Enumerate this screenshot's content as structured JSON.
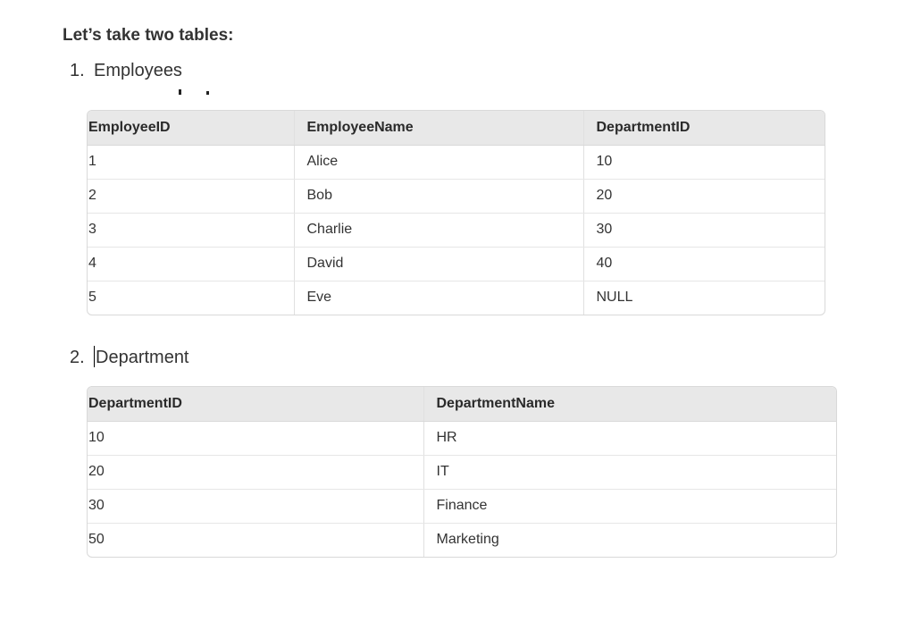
{
  "heading": "Let’s take two tables:",
  "list": [
    {
      "number": "1.",
      "label": "Employees"
    },
    {
      "number": "2.",
      "label": "Department"
    }
  ],
  "employees_table": {
    "headers": [
      "EmployeeID",
      "EmployeeName",
      "DepartmentID"
    ],
    "rows": [
      [
        "1",
        "Alice",
        "10"
      ],
      [
        "2",
        "Bob",
        "20"
      ],
      [
        "3",
        "Charlie",
        "30"
      ],
      [
        "4",
        "David",
        "40"
      ],
      [
        "5",
        "Eve",
        "NULL"
      ]
    ]
  },
  "department_table": {
    "headers": [
      "DepartmentID",
      "DepartmentName"
    ],
    "rows": [
      [
        "10",
        "HR"
      ],
      [
        "20",
        "IT"
      ],
      [
        "30",
        "Finance"
      ],
      [
        "50",
        "Marketing"
      ]
    ]
  }
}
